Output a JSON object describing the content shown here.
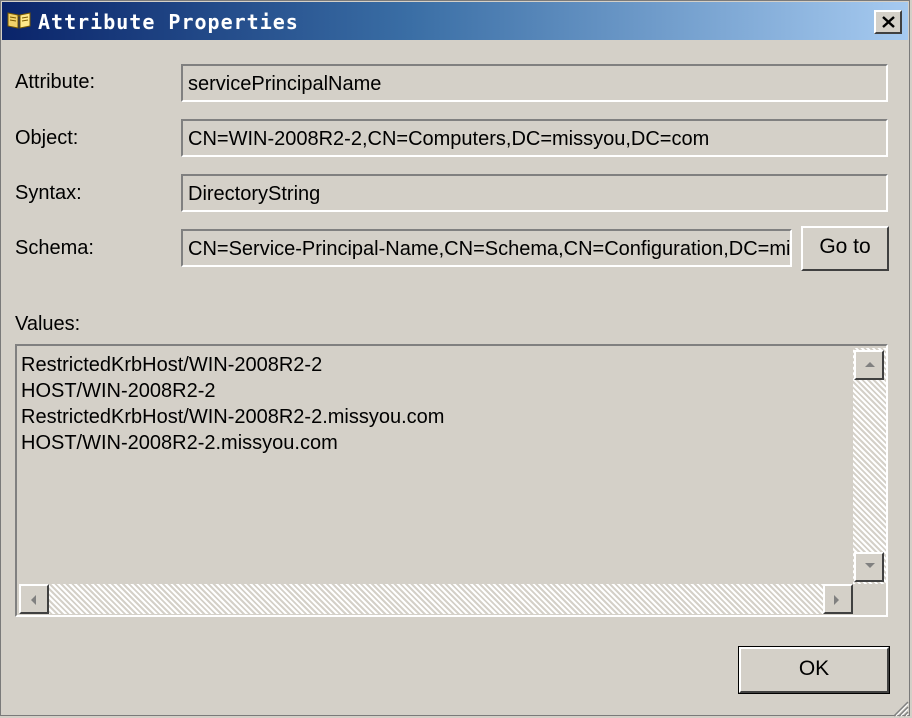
{
  "window": {
    "title": "Attribute Properties",
    "title_icon": "open-book-icon",
    "close_icon": "close-x-icon"
  },
  "fields": {
    "attribute": {
      "label": "Attribute:",
      "value": "servicePrincipalName"
    },
    "object": {
      "label": "Object:",
      "value": "CN=WIN-2008R2-2,CN=Computers,DC=missyou,DC=com"
    },
    "syntax": {
      "label": "Syntax:",
      "value": "DirectoryString"
    },
    "schema": {
      "label": "Schema:",
      "value": "CN=Service-Principal-Name,CN=Schema,CN=Configuration,DC=missyou,DC=com"
    }
  },
  "buttons": {
    "goto": "Go to",
    "ok": "OK"
  },
  "values": {
    "label": "Values:",
    "items": [
      "RestrictedKrbHost/WIN-2008R2-2",
      "HOST/WIN-2008R2-2",
      "RestrictedKrbHost/WIN-2008R2-2.missyou.com",
      "HOST/WIN-2008R2-2.missyou.com"
    ]
  },
  "colors": {
    "title_gradient_start": "#0a246a",
    "title_gradient_end": "#a6caf0",
    "dialog_background": "#d4d0c8"
  }
}
